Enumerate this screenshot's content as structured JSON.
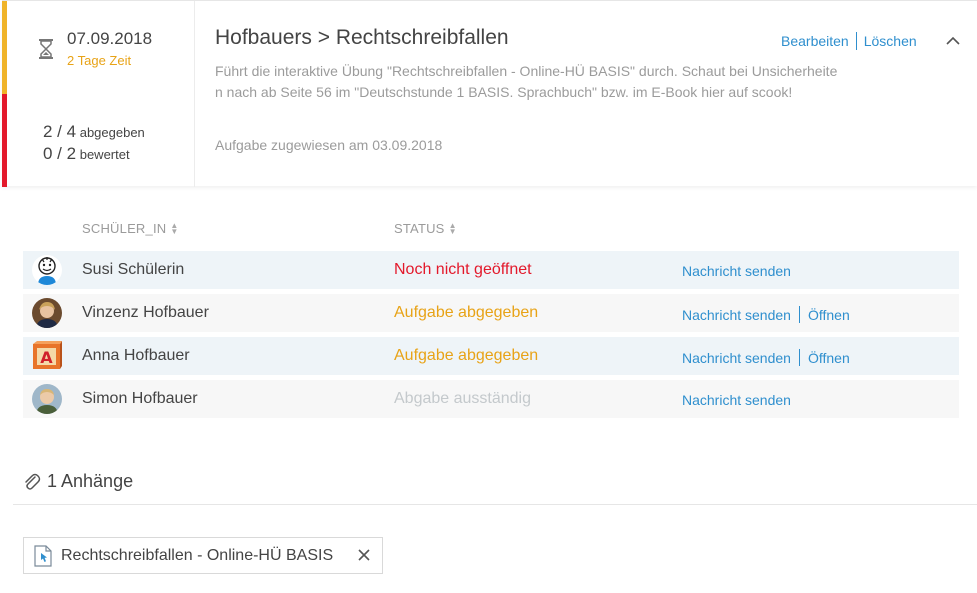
{
  "assignment": {
    "due_date": "07.09.2018",
    "time_left": "2 Tage Zeit",
    "submitted": {
      "count": "2 / 4",
      "label": "abgegeben"
    },
    "graded": {
      "count": "0 / 2",
      "label": "bewertet"
    },
    "title": "Hofbauers > Rechtschreibfallen",
    "description": "Führt die interaktive Übung \"Rechtschreibfallen - Online-HÜ BASIS\" durch. Schaut bei Unsicherheiten nach ab Seite 56 im \"Deutschstunde 1 BASIS. Sprachbuch\" bzw. im E-Book hier auf scook!",
    "assigned_on": "Aufgabe zugewiesen am 03.09.2018",
    "edit_label": "Bearbeiten",
    "delete_label": "Löschen",
    "colors": {
      "accent": "#2f8fce",
      "warning": "#f0b429",
      "danger": "#e3192b"
    }
  },
  "table": {
    "col_student": "SCHÜLER_IN",
    "col_status": "STATUS",
    "rows": [
      {
        "name": "Susi Schülerin",
        "status": "Noch nicht geöffnet",
        "status_color": "#e3192b",
        "message": "Nachricht senden",
        "open": "",
        "avatar": "cartoon-avatar-icon"
      },
      {
        "name": "Vinzenz Hofbauer",
        "status": "Aufgabe abgegeben",
        "status_color": "#e8a317",
        "message": "Nachricht senden",
        "open": "Öffnen",
        "avatar": "photo-avatar"
      },
      {
        "name": "Anna Hofbauer",
        "status": "Aufgabe abgegeben",
        "status_color": "#e8a317",
        "message": "Nachricht senden",
        "open": "Öffnen",
        "avatar": "letter-block-avatar-icon"
      },
      {
        "name": "Simon Hofbauer",
        "status": "Abgabe ausständig",
        "status_color": "#c4c9cc",
        "message": "Nachricht senden",
        "open": "",
        "avatar": "photo-avatar"
      }
    ]
  },
  "attachments": {
    "title": "1 Anhänge",
    "items": [
      {
        "label": "Rechtschreibfallen - Online-HÜ BASIS",
        "icon": "interactive-file-icon"
      }
    ]
  }
}
